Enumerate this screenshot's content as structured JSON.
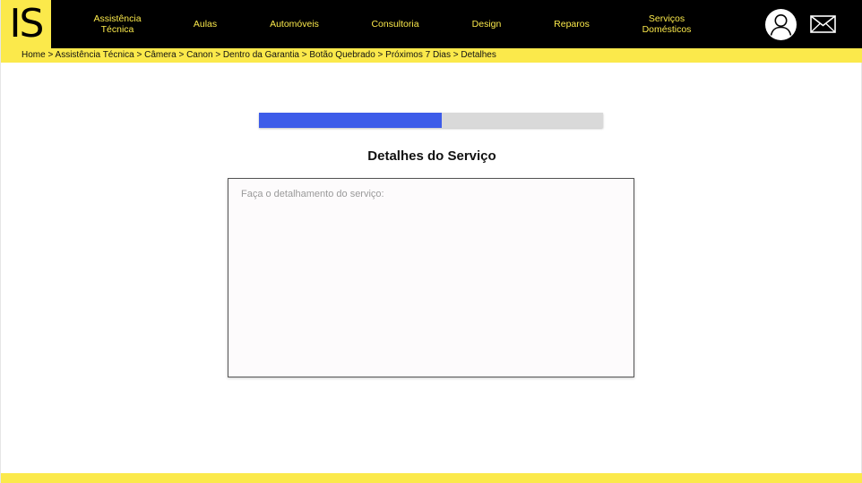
{
  "brand": {
    "logo_text": "IS"
  },
  "nav": {
    "items": [
      {
        "label": "Assistência Técnica"
      },
      {
        "label": "Aulas"
      },
      {
        "label": "Automóveis"
      },
      {
        "label": "Consultoria"
      },
      {
        "label": "Design"
      },
      {
        "label": "Reparos"
      },
      {
        "label": "Serviços Domésticos"
      }
    ],
    "user_icon": "user-avatar-icon",
    "mail_icon": "envelope-icon"
  },
  "breadcrumb": {
    "text": "Home > Assistência Técnica > Câmera > Canon > Dentro da Garantia > Botão Quebrado > Próximos 7 Dias > Detalhes"
  },
  "progress": {
    "fraction": 0.53
  },
  "main": {
    "title": "Detalhes do Serviço",
    "details_placeholder": "Faça o detalhamento do serviço:",
    "details_value": ""
  },
  "colors": {
    "accent_yellow": "#fbe94b",
    "progress_blue": "#3d5ce9",
    "nav_background": "#000000"
  }
}
